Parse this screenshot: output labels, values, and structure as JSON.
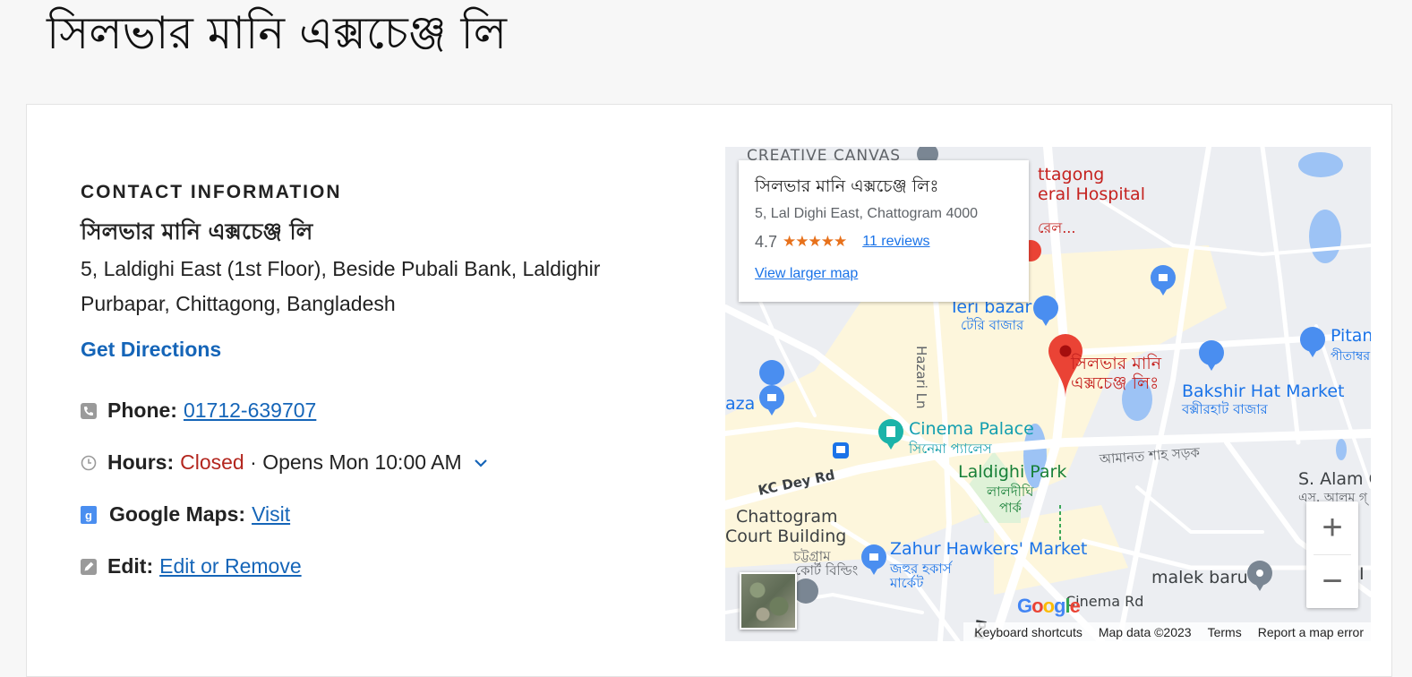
{
  "page": {
    "title": "সিলভার মানি এক্সচেঞ্জ লি"
  },
  "contact": {
    "heading": "CONTACT INFORMATION",
    "business_name": "সিলভার মানি এক্সচেঞ্জ লি",
    "address_line1": "5, Laldighi East (1st Floor), Beside Pubali Bank, Laldighir",
    "address_line2": "Purbapar, Chittagong, Bangladesh",
    "directions_label": "Get Directions",
    "phone": {
      "label": "Phone:",
      "value": "01712-639707",
      "icon": "phone-icon"
    },
    "hours": {
      "label": "Hours:",
      "status": "Closed",
      "separator": " · ",
      "opens": "Opens Mon 10:00 AM",
      "icon": "clock-icon"
    },
    "google_maps": {
      "label": "Google Maps:",
      "link": "Visit",
      "icon": "google-g-icon"
    },
    "edit": {
      "label": "Edit:",
      "link": "Edit or Remove",
      "icon": "pencil-icon"
    }
  },
  "map": {
    "info_card": {
      "title": "সিলভার মানি এক্সচেঞ্জ লিঃ",
      "address": "5, Lal Dighi East, Chattogram 4000",
      "rating": "4.7",
      "stars": "★★★★★",
      "reviews": "11 reviews",
      "larger_map": "View larger map"
    },
    "labels": {
      "creative_canvas": "CREATIVE CANVAS",
      "hospital_1": "ttagong",
      "hospital_2": "eral Hospital",
      "hospital_bn": "রেল...",
      "teri_bazar": "Teri bazar",
      "teri_bazar_bn": "টেরি বাজার",
      "hazari_ln": "Hazari Ln",
      "pin_name_1": "সিলভার মানি",
      "pin_name_2": "এক্সচেঞ্জ লিঃ",
      "pitan": "Pitan",
      "pitan_bn": "পীতাম্বর",
      "bakshir_hat": "Bakshir Hat Market",
      "bakshir_hat_bn": "বক্সীরহাট বাজার",
      "aza": "aza",
      "cinema_palace": "Cinema Palace",
      "cinema_palace_bn": "সিনেমা প্যালেস",
      "amanat_shah": "আমানত শাহ সড়ক",
      "kc_dey": "KC Dey Rd",
      "laldighi_park": "Laldighi Park",
      "laldighi_park_bn1": "লালদীঘি",
      "laldighi_park_bn2": "পার্ক",
      "s_alam": "S. Alam Gro",
      "s_alam_bn": "এস. আলম গ্",
      "court_1": "Chattogram",
      "court_2": "Court Building",
      "court_bn1": "চট্টগ্রাম",
      "court_bn2": "কোর্ট বিল্ডিং",
      "zahur_1": "Zahur Hawkers' Market",
      "zahur_bn1": "জহুর হকার্স",
      "zahur_bn2": "মার্কেট",
      "malek_baru": "malek baru",
      "bi": "BI",
      "cinema_rd": "Cinema Rd",
      "rd_vertical": "Rd"
    },
    "zoom_in": "+",
    "zoom_out": "−",
    "google_logo": "Google",
    "footer": {
      "shortcuts": "Keyboard shortcuts",
      "map_data": "Map data ©2023",
      "terms": "Terms",
      "report": "Report a map error"
    },
    "colors": {
      "road": "#ffffff",
      "land": "#eceef2",
      "commercial": "#fdf6dc",
      "water": "#9dc3f5",
      "park": "#c7eac4",
      "pin": "#ea4335",
      "poi_blue": "#4a8ef0",
      "poi_teal": "#1bb3a9"
    }
  }
}
